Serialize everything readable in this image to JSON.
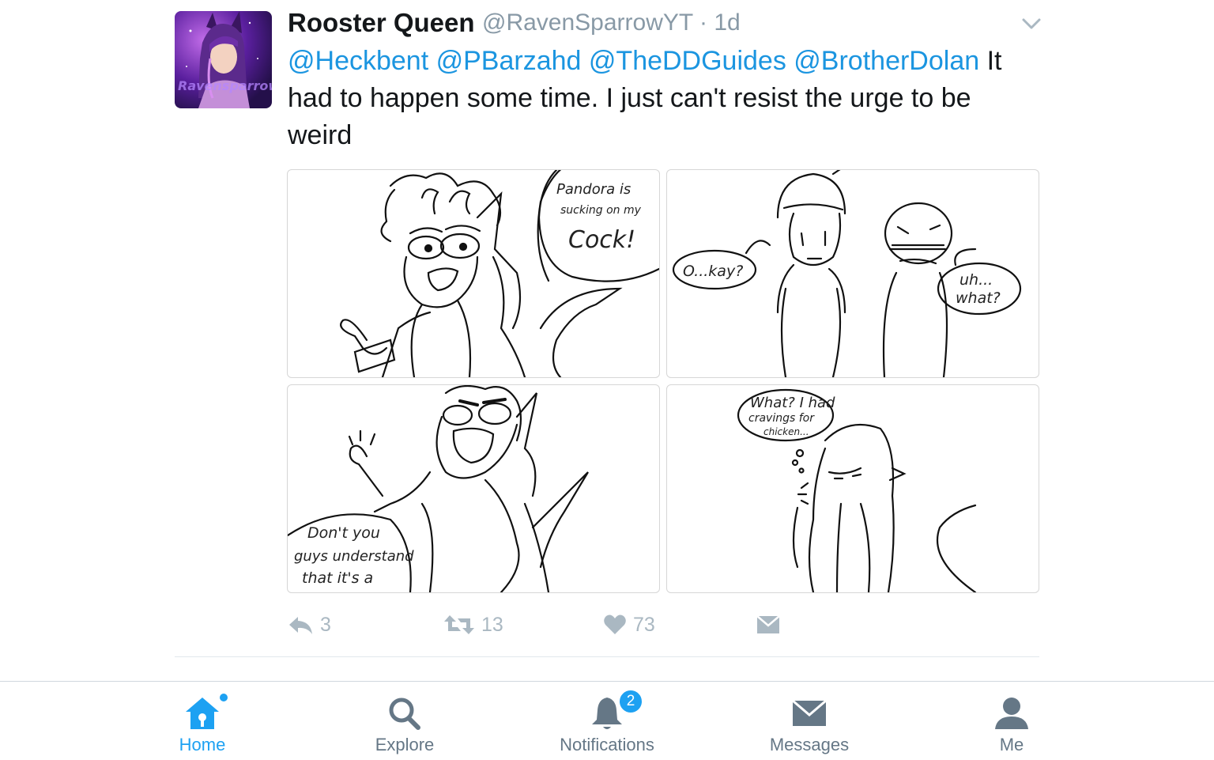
{
  "tweet": {
    "author_name": "Rooster Queen",
    "handle": "@RavenSparrowYT",
    "time_sep": " · ",
    "time": "1d",
    "avatar_watermark": "Ravensparrow",
    "mentions": [
      "@Heckbent",
      "@PBarzahd",
      "@TheDDGuides",
      "@BrotherDolan"
    ],
    "body": "It had to happen some time. I just can't resist the urge to be weird",
    "comic": {
      "panel1": [
        "Pandora is",
        "sucking on my",
        "Cock!"
      ],
      "panel2": [
        "O...kay?",
        "uh...",
        "what?"
      ],
      "panel3": [
        "Don't you",
        "guys understand",
        "that it's a"
      ],
      "panel4": [
        "What? I had",
        "cravings for",
        "chicken..."
      ]
    },
    "actions": {
      "replies": "3",
      "retweets": "13",
      "likes": "73"
    }
  },
  "tabbar": {
    "home": "Home",
    "explore": "Explore",
    "notifications": "Notifications",
    "notifications_badge": "2",
    "messages": "Messages",
    "me": "Me"
  },
  "colors": {
    "accent": "#1da1f2",
    "mention": "#1b95e0",
    "muted": "#8899a6",
    "icon_gray": "#aab8c2"
  }
}
